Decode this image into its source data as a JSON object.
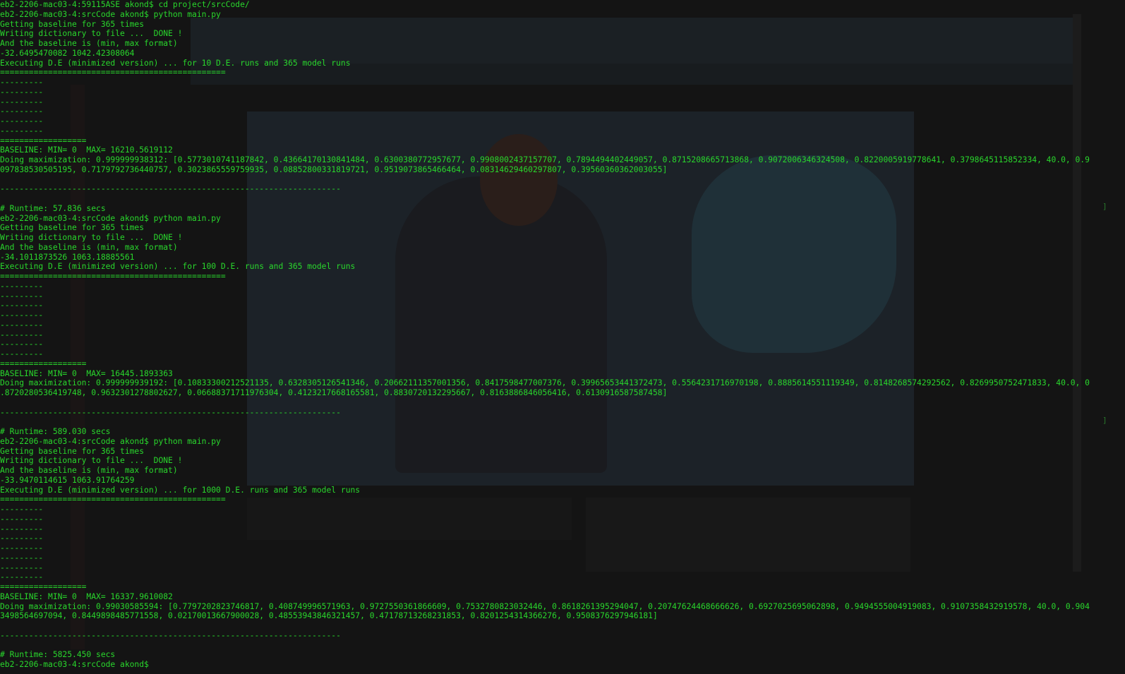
{
  "terminal": {
    "lines": [
      "eb2-2206-mac03-4:59115ASE akond$ cd project/srcCode/",
      "eb2-2206-mac03-4:srcCode akond$ python main.py",
      "Getting baseline for 365 times",
      "Writing dictionary to file ...  DONE !",
      "And the baseline is (min, max format)",
      "-32.6495470082 1042.42308064",
      "Executing D.E (minimized version) ... for 10 D.E. runs and 365 model runs",
      "===============================================",
      "---------",
      "---------",
      "---------",
      "---------",
      "---------",
      "---------",
      "==================",
      "BASELINE: MIN= 0  MAX= 16210.5619112",
      "Doing maximization: 0.999999938312: [0.5773010741187842, 0.43664170130841484, 0.6300380772957677, 0.9908002437157707, 0.7894494402449057, 0.8715208665713868, 0.9072006346324508, 0.8220005919778641, 0.3798645115852334, 40.0, 0.9",
      "097838530505195, 0.7179792736440757, 0.3023865559759935, 0.08852800331819721, 0.9519073865466464, 0.08314629460297807, 0.39560360362003055]",
      "",
      "-----------------------------------------------------------------------",
      "",
      "# Runtime: 57.836 secs",
      "eb2-2206-mac03-4:srcCode akond$ python main.py",
      "Getting baseline for 365 times",
      "Writing dictionary to file ...  DONE !",
      "And the baseline is (min, max format)",
      "-34.1011873526 1063.18885561",
      "Executing D.E (minimized version) ... for 100 D.E. runs and 365 model runs",
      "===============================================",
      "---------",
      "---------",
      "---------",
      "---------",
      "---------",
      "---------",
      "---------",
      "---------",
      "==================",
      "BASELINE: MIN= 0  MAX= 16445.1893363",
      "Doing maximization: 0.999999939192: [0.10833300212521135, 0.6328305126541346, 0.20662111357001356, 0.8417598477007376, 0.39965653441372473, 0.5564231716970198, 0.8885614551119349, 0.8148268574292562, 0.8269950752471833, 40.0, 0",
      ".8720280536419748, 0.9632301278802627, 0.06688371711976304, 0.4123217668165581, 0.8830720132295667, 0.8163886846056416, 0.6130916587587458]",
      "",
      "-----------------------------------------------------------------------",
      "",
      "# Runtime: 589.030 secs",
      "eb2-2206-mac03-4:srcCode akond$ python main.py",
      "Getting baseline for 365 times",
      "Writing dictionary to file ...  DONE !",
      "And the baseline is (min, max format)",
      "-33.9470114615 1063.91764259",
      "Executing D.E (minimized version) ... for 1000 D.E. runs and 365 model runs",
      "===============================================",
      "---------",
      "---------",
      "---------",
      "---------",
      "---------",
      "---------",
      "---------",
      "---------",
      "==================",
      "BASELINE: MIN= 0  MAX= 16337.9610082",
      "Doing maximization: 0.99030585594: [0.7797202823746817, 0.408749996571963, 0.9727550361866609, 0.7532780823032446, 0.8618261395294047, 0.20747624468666626, 0.6927025695062898, 0.9494555004919083, 0.9107358432919578, 40.0, 0.904",
      "3498564697094, 0.8449898485771558, 0.02170013667900028, 0.48553943846321457, 0.47178713268231853, 0.8201254314366276, 0.9508376297946181]",
      "",
      "-----------------------------------------------------------------------",
      "",
      "# Runtime: 5825.450 secs",
      "eb2-2206-mac03-4:srcCode akond$"
    ],
    "edge_marks": [
      "]",
      "]"
    ]
  },
  "colors": {
    "foreground": "#29d72c",
    "background": "#141414"
  }
}
